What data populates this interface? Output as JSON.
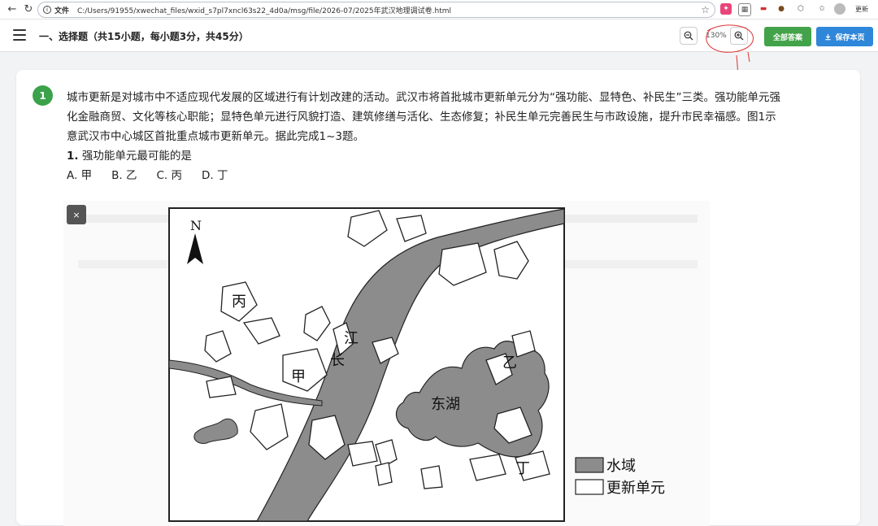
{
  "browser": {
    "scheme": "文件",
    "url": "C:/Users/91955/xwechat_files/wxid_s7pl7xncl63s22_4d0a/msg/file/2026-07/2025年武汉地理调试卷.html",
    "update_label": "更新"
  },
  "toolbar": {
    "title": "一、选择题（共15小题，每小题3分，共45分）",
    "zoom_level": "130%",
    "all_answers_label": "全部答案",
    "save_label": "保存本页",
    "save_icon": "download-icon"
  },
  "question": {
    "number": "1",
    "passage_lines": [
      "城市更新是对城市中不适应现代发展的区域进行有计划改建的活动。武汉市将首批城市更新单元分为“强功能、显特色、补民生”三类。强功能单元强",
      "化金融商贸、文化等核心职能；显特色单元进行风貌打造、建筑修缮与活化、生态修复；补民生单元完善民生与市政设施，提升市民幸福感。图1示",
      "意武汉市中心城区首批重点城市更新单元。据此完成1~3题。"
    ],
    "sub_number": "1.",
    "sub_text": "强功能单元最可能的是",
    "options": [
      "A. 甲",
      "B. 乙",
      "C. 丙",
      "D. 丁"
    ]
  },
  "figure": {
    "close_label": "×",
    "north_label": "N",
    "river_label_1": "江",
    "river_label_2": "长",
    "lake_label": "东湖",
    "unit_labels": [
      "甲",
      "乙",
      "丙",
      "丁"
    ],
    "legend_water": "水域",
    "legend_unit": "更新单元",
    "colors": {
      "water": "#8c8c8c",
      "unit_fill": "#ffffff",
      "outline": "#222222"
    }
  }
}
